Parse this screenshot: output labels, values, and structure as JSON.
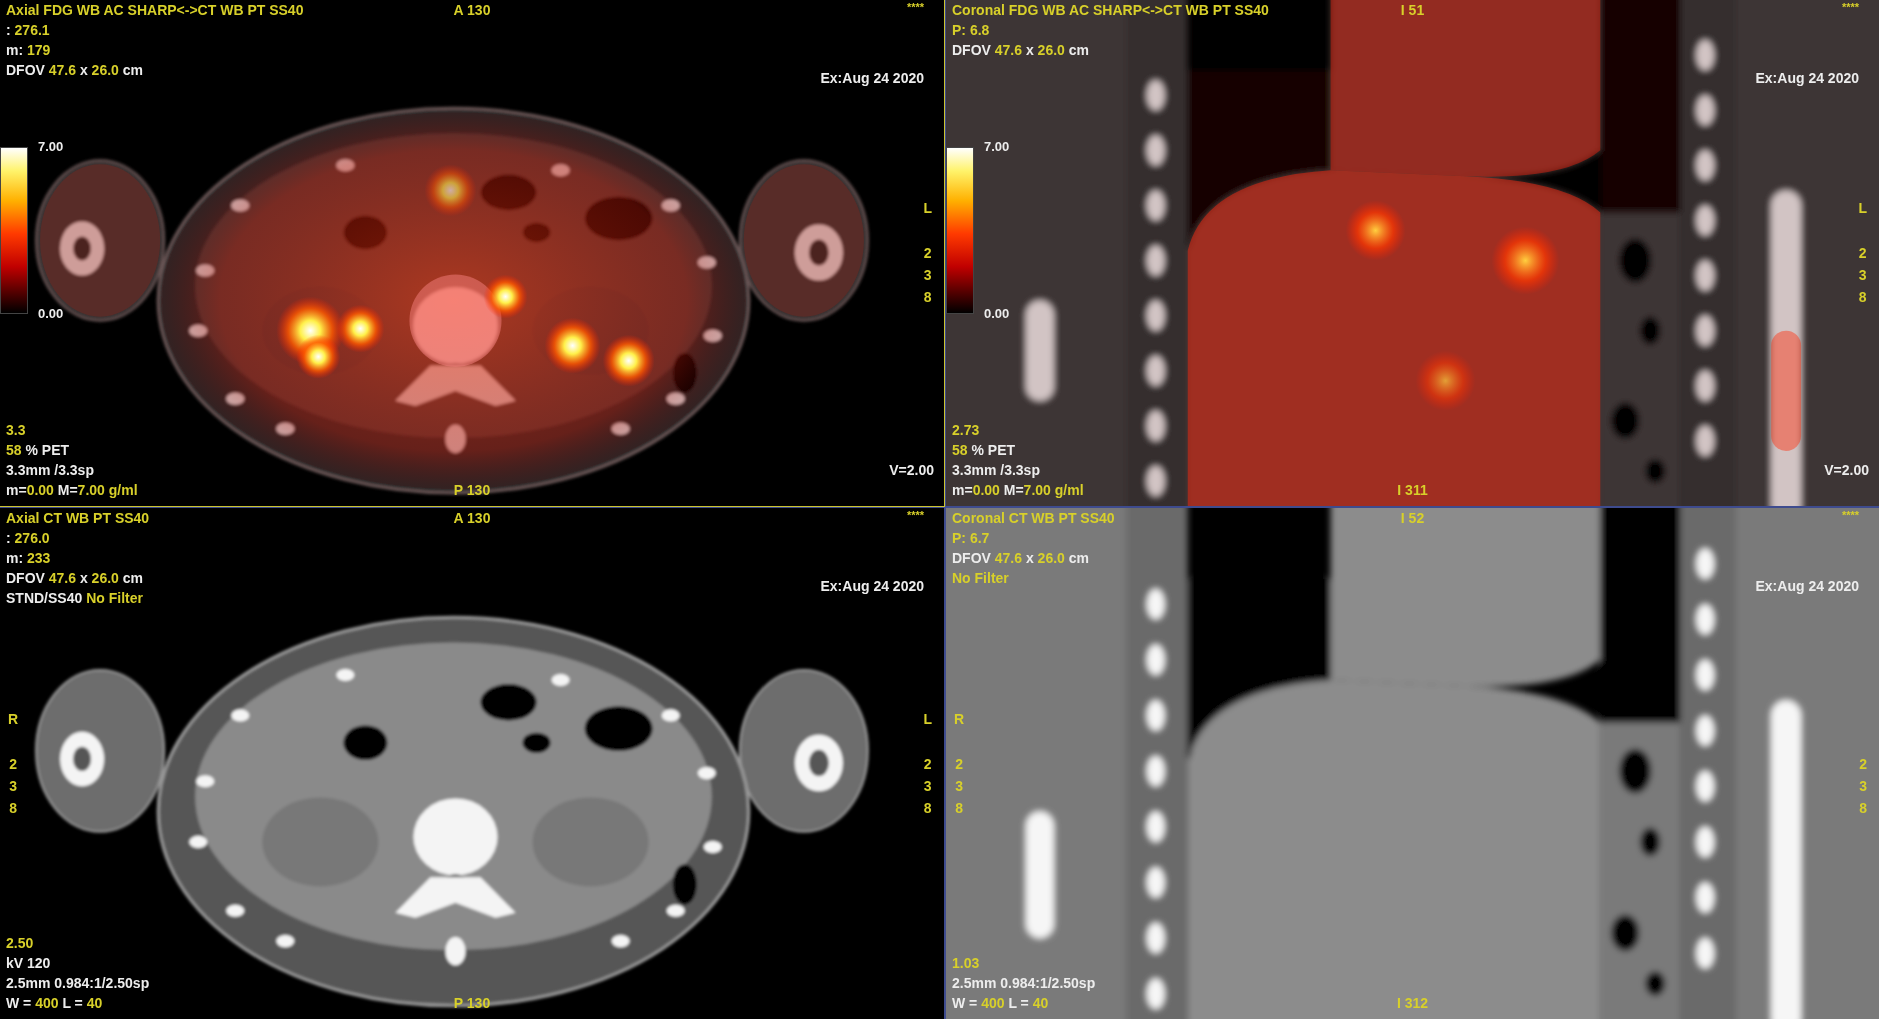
{
  "viewer": {
    "panes": [
      {
        "selected": true,
        "kind": "axial",
        "fusion": true,
        "top_left": [
          {
            "segments": [
              {
                "text": "Axial FDG WB AC SHARP<->CT WB PT SS40",
                "kind": "value"
              }
            ]
          },
          {
            "segments": [
              {
                "text": ": ",
                "kind": "label"
              },
              {
                "text": "276.1",
                "kind": "value"
              }
            ]
          },
          {
            "segments": [
              {
                "text": "m: ",
                "kind": "label"
              },
              {
                "text": "179",
                "kind": "value"
              }
            ]
          },
          {
            "segments": [
              {
                "text": "DFOV ",
                "kind": "label"
              },
              {
                "text": "47.6",
                "kind": "value"
              },
              {
                "text": " x ",
                "kind": "label"
              },
              {
                "text": "26.0",
                "kind": "value"
              },
              {
                "text": " cm",
                "kind": "label"
              }
            ]
          }
        ],
        "top_center": "A 130",
        "top_right": "****",
        "exam_date": "Ex:Aug 24 2020",
        "color_scale": {
          "max": "7.00",
          "min": "0.00"
        },
        "right_side": {
          "orientation": "L",
          "marks": [
            "2",
            "3",
            "8"
          ]
        },
        "bottom_left": [
          {
            "segments": [
              {
                "text": "3.3",
                "kind": "value"
              }
            ]
          },
          {
            "segments": [
              {
                "text": "58",
                "kind": "value"
              },
              {
                "text": " % PET",
                "kind": "label"
              }
            ]
          },
          {
            "segments": [
              {
                "text": "3.3mm /3.3sp",
                "kind": "label"
              }
            ]
          },
          {
            "segments": [
              {
                "text": "m=",
                "kind": "label"
              },
              {
                "text": "0.00",
                "kind": "value"
              },
              {
                "text": " M=",
                "kind": "label"
              },
              {
                "text": "7.00 g/ml",
                "kind": "value"
              }
            ]
          }
        ],
        "bottom_center": "P 130",
        "bottom_right": "V=2.00"
      },
      {
        "selected": false,
        "kind": "coronal",
        "fusion": true,
        "top_left": [
          {
            "segments": [
              {
                "text": "Coronal FDG WB AC SHARP<->CT WB PT SS40",
                "kind": "value"
              }
            ]
          },
          {
            "segments": [
              {
                "text": "P: 6.8",
                "kind": "value"
              }
            ]
          },
          {
            "segments": [
              {
                "text": "DFOV ",
                "kind": "label"
              },
              {
                "text": "47.6",
                "kind": "value"
              },
              {
                "text": " x ",
                "kind": "label"
              },
              {
                "text": "26.0",
                "kind": "value"
              },
              {
                "text": " cm",
                "kind": "label"
              }
            ]
          }
        ],
        "top_center": "I 51",
        "top_right": "****",
        "exam_date": "Ex:Aug 24 2020",
        "color_scale": {
          "max": "7.00",
          "min": "0.00"
        },
        "right_side": {
          "orientation": "L",
          "marks": [
            "2",
            "3",
            "8"
          ]
        },
        "bottom_left": [
          {
            "segments": [
              {
                "text": "2.73",
                "kind": "value"
              }
            ]
          },
          {
            "segments": [
              {
                "text": "58",
                "kind": "value"
              },
              {
                "text": " % PET",
                "kind": "label"
              }
            ]
          },
          {
            "segments": [
              {
                "text": "3.3mm /3.3sp",
                "kind": "label"
              }
            ]
          },
          {
            "segments": [
              {
                "text": "m=",
                "kind": "label"
              },
              {
                "text": "0.00",
                "kind": "value"
              },
              {
                "text": " M=",
                "kind": "label"
              },
              {
                "text": "7.00 g/ml",
                "kind": "value"
              }
            ]
          }
        ],
        "bottom_center": "I 311",
        "bottom_right": "V=2.00"
      },
      {
        "selected": false,
        "kind": "axial",
        "fusion": false,
        "top_left": [
          {
            "segments": [
              {
                "text": "Axial CT WB PT SS40",
                "kind": "value"
              }
            ]
          },
          {
            "segments": [
              {
                "text": ": ",
                "kind": "label"
              },
              {
                "text": "276.0",
                "kind": "value"
              }
            ]
          },
          {
            "segments": [
              {
                "text": "m: ",
                "kind": "label"
              },
              {
                "text": "233",
                "kind": "value"
              }
            ]
          },
          {
            "segments": [
              {
                "text": "DFOV ",
                "kind": "label"
              },
              {
                "text": "47.6",
                "kind": "value"
              },
              {
                "text": " x ",
                "kind": "label"
              },
              {
                "text": "26.0",
                "kind": "value"
              },
              {
                "text": " cm",
                "kind": "label"
              }
            ]
          },
          {
            "segments": [
              {
                "text": "STND/SS40 ",
                "kind": "label"
              },
              {
                "text": "No Filter",
                "kind": "value"
              }
            ]
          }
        ],
        "top_center": "A 130",
        "top_right": "****",
        "exam_date": "Ex:Aug 24 2020",
        "left_side": {
          "orientation": "R",
          "marks": [
            "2",
            "3",
            "8"
          ]
        },
        "right_side": {
          "orientation": "L",
          "marks": [
            "2",
            "3",
            "8"
          ]
        },
        "bottom_left": [
          {
            "segments": [
              {
                "text": "2.50",
                "kind": "value"
              }
            ]
          },
          {
            "segments": [
              {
                "text": "kV 120",
                "kind": "label"
              }
            ]
          },
          {
            "segments": [
              {
                "text": "2.5mm 0.984:1/2.50sp",
                "kind": "label"
              }
            ]
          },
          {
            "segments": [
              {
                "text": "W = ",
                "kind": "label"
              },
              {
                "text": "400",
                "kind": "value"
              },
              {
                "text": " L = ",
                "kind": "label"
              },
              {
                "text": "40",
                "kind": "value"
              }
            ]
          }
        ],
        "bottom_center": "P 130"
      },
      {
        "selected": false,
        "kind": "coronal",
        "fusion": false,
        "top_left": [
          {
            "segments": [
              {
                "text": "Coronal CT WB PT SS40",
                "kind": "value"
              }
            ]
          },
          {
            "segments": [
              {
                "text": "P: 6.7",
                "kind": "value"
              }
            ]
          },
          {
            "segments": [
              {
                "text": "DFOV ",
                "kind": "label"
              },
              {
                "text": "47.6",
                "kind": "value"
              },
              {
                "text": " x ",
                "kind": "label"
              },
              {
                "text": "26.0",
                "kind": "value"
              },
              {
                "text": " cm",
                "kind": "label"
              }
            ]
          },
          {
            "segments": [
              {
                "text": "No Filter",
                "kind": "value"
              }
            ]
          }
        ],
        "top_center": "I 52",
        "top_right": "****",
        "exam_date": "Ex:Aug 24 2020",
        "left_side": {
          "orientation": "R",
          "marks": [
            "2",
            "3",
            "8"
          ]
        },
        "right_side": {
          "marks": [
            "2",
            "3",
            "8"
          ]
        },
        "bottom_left": [
          {
            "segments": [
              {
                "text": "1.03",
                "kind": "value"
              }
            ]
          },
          {
            "segments": [
              {
                "text": "2.5mm 0.984:1/2.50sp",
                "kind": "label"
              }
            ]
          },
          {
            "segments": [
              {
                "text": "W = ",
                "kind": "label"
              },
              {
                "text": "400",
                "kind": "value"
              },
              {
                "text": " L = ",
                "kind": "label"
              },
              {
                "text": "40",
                "kind": "value"
              }
            ]
          }
        ],
        "bottom_center": "I 312"
      }
    ]
  }
}
